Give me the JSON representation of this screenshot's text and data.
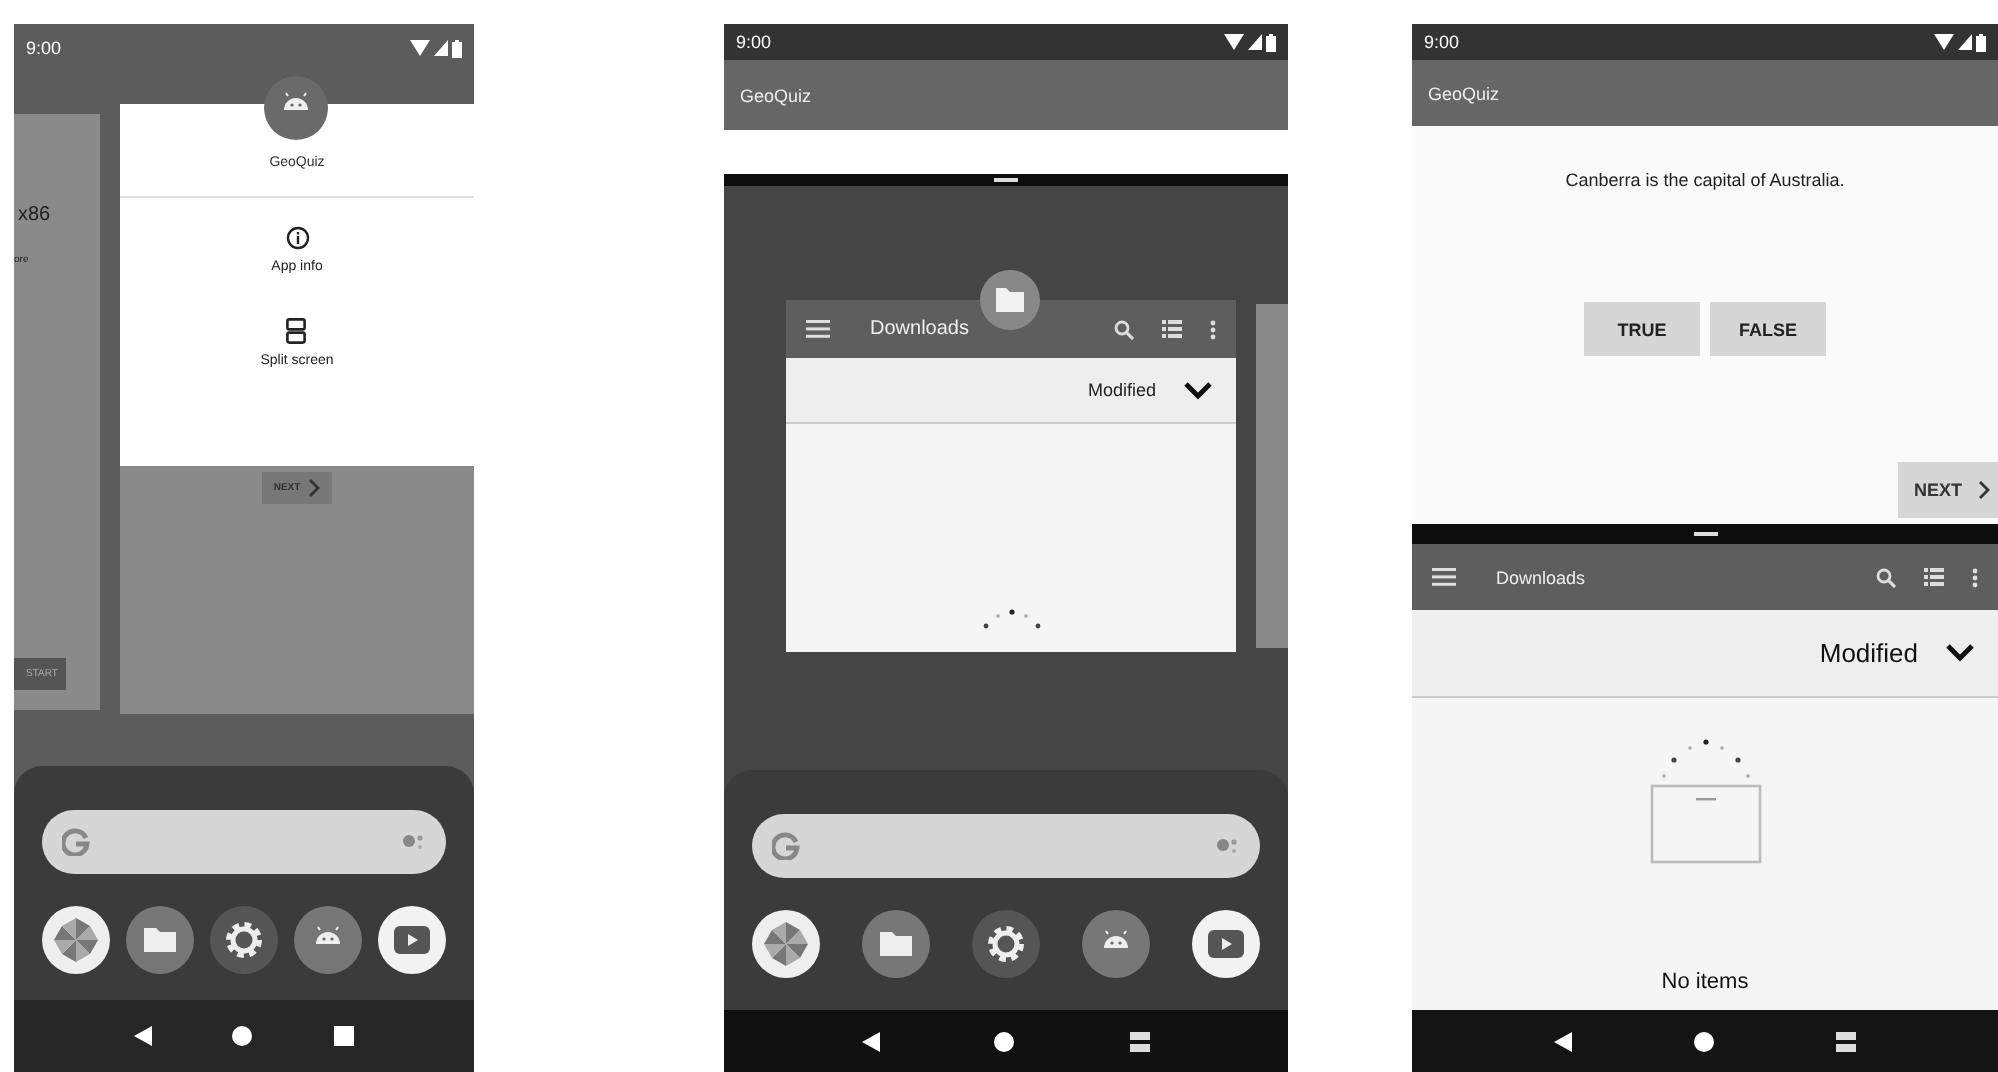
{
  "phones": [
    {
      "kind": "recents",
      "status_bar": {
        "time": "9:00"
      },
      "side_card": {
        "title": "x86",
        "line": "ore",
        "button": "START"
      },
      "app_card": {
        "app_name": "GeoQuiz",
        "menu": [
          {
            "kind": "info",
            "label": "App info"
          },
          {
            "kind": "split",
            "label": "Split screen"
          }
        ],
        "next_button": "NEXT"
      }
    },
    {
      "kind": "split_recents",
      "status_bar": {
        "time": "9:00"
      },
      "app_bar": {
        "title": "GeoQuiz"
      },
      "downloads_card": {
        "title": "Downloads",
        "sort": "Modified"
      }
    },
    {
      "kind": "split_screen",
      "status_bar": {
        "time": "9:00"
      },
      "app_bar": {
        "title": "GeoQuiz"
      },
      "question": "Canberra is the capital of Australia.",
      "answer_buttons": [
        "TRUE",
        "FALSE"
      ],
      "next_button": "NEXT",
      "downloads": {
        "title": "Downloads",
        "sort": "Modified",
        "empty_text": "No items"
      }
    }
  ]
}
